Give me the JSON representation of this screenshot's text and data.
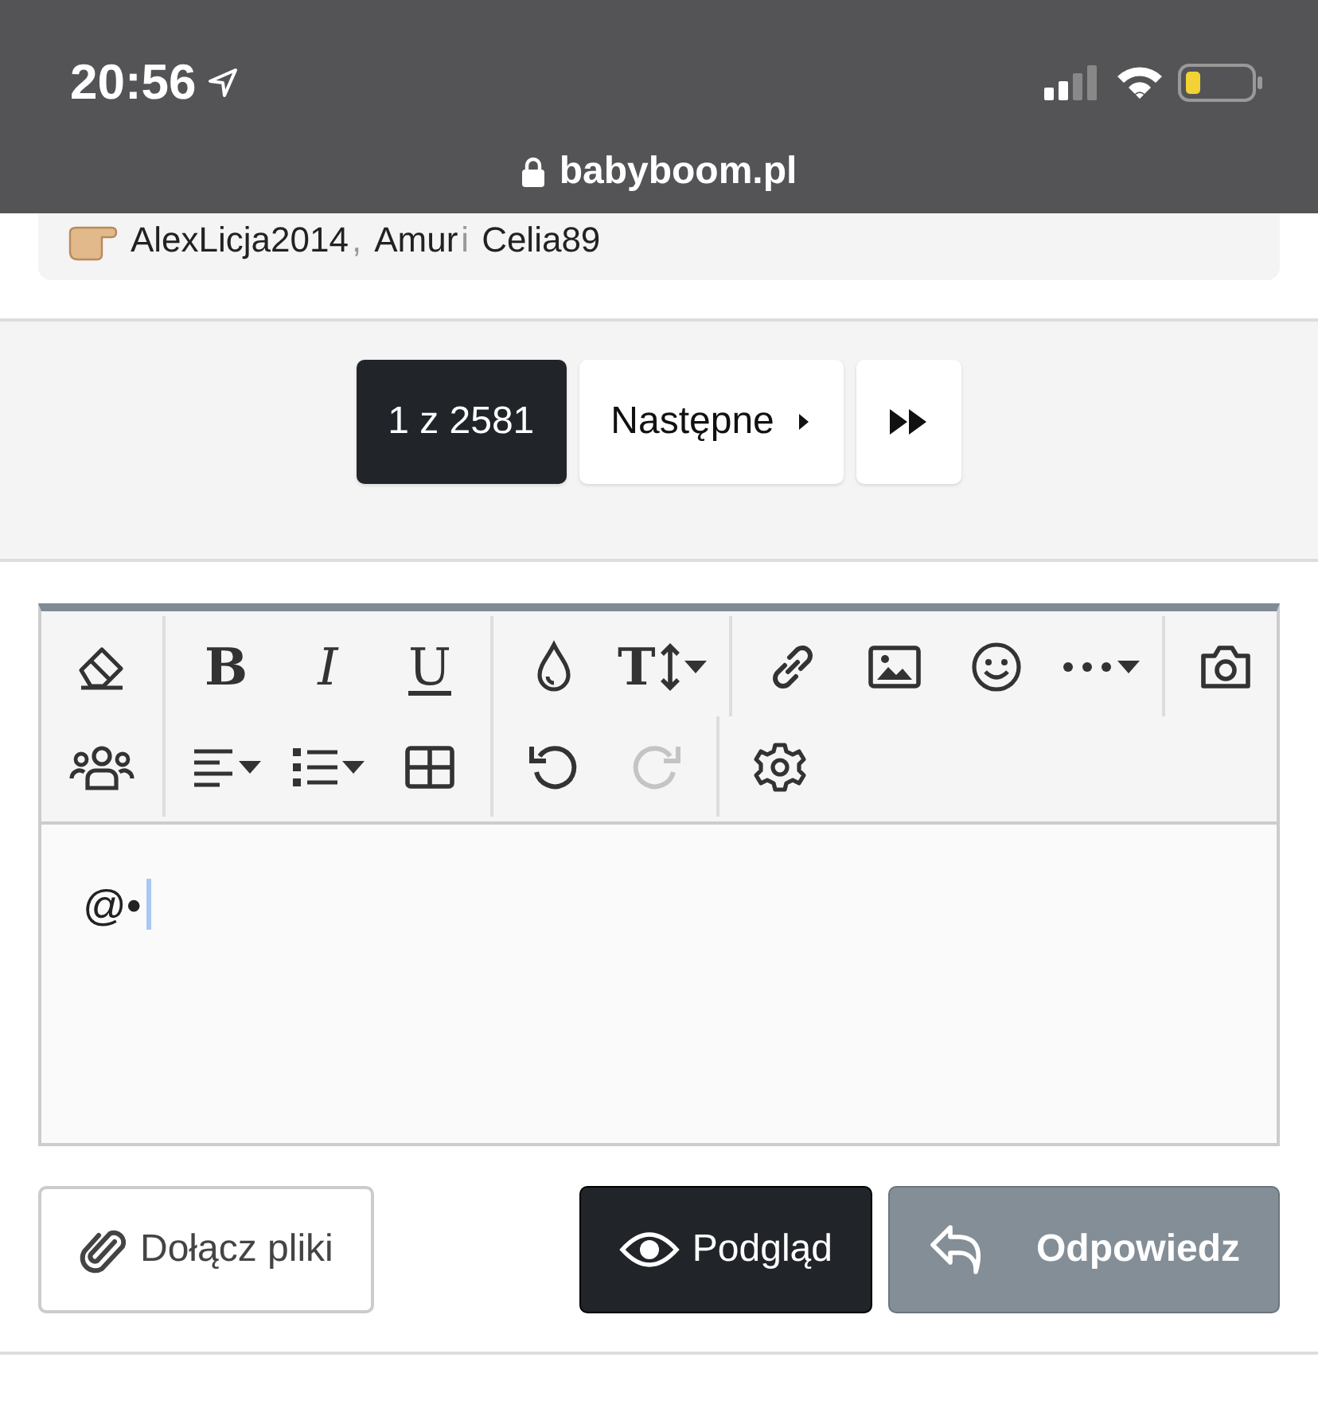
{
  "status_bar": {
    "time": "20:56",
    "url": "babyboom.pl"
  },
  "likes": {
    "parts": [
      {
        "text": "AlexLicja2014",
        "kind": "name"
      },
      {
        "text": ",",
        "kind": "sep"
      },
      {
        "text": "Amur",
        "kind": "name"
      },
      {
        "text": "i",
        "kind": "sep"
      },
      {
        "text": "Celia89",
        "kind": "name"
      }
    ]
  },
  "pagination": {
    "items": [
      {
        "kind": "page",
        "label": "1 z 2581",
        "selected": true
      },
      {
        "kind": "next",
        "label": "Następne",
        "selected": false
      },
      {
        "kind": "last",
        "selected": false
      }
    ]
  },
  "toolbar": {
    "rows": [
      [
        [
          {
            "disabled": false
          }
        ],
        [
          {
            "glyph": "B",
            "disabled": false
          },
          {
            "glyph": "I",
            "disabled": false
          },
          {
            "glyph": "U",
            "disabled": false
          }
        ],
        [
          {
            "disabled": false
          },
          {
            "glyph": "T",
            "disabled": false
          }
        ],
        [
          {
            "disabled": false
          },
          {
            "disabled": false
          },
          {
            "disabled": false
          },
          {
            "disabled": false
          }
        ],
        [
          {
            "disabled": false
          }
        ]
      ],
      [
        [
          {
            "disabled": false
          }
        ],
        [
          {
            "disabled": false
          },
          {
            "disabled": false
          },
          {
            "disabled": false
          }
        ],
        [
          {
            "disabled": false
          },
          {
            "disabled": true
          }
        ],
        [
          {
            "disabled": false
          }
        ]
      ]
    ]
  },
  "editor": {
    "value": "@•"
  },
  "buttons": [
    {
      "kind": "attach",
      "label": "Dołącz pliki"
    },
    {
      "kind": "preview",
      "label": "Podgląd"
    },
    {
      "kind": "reply",
      "label": "Odpowiedz"
    }
  ]
}
